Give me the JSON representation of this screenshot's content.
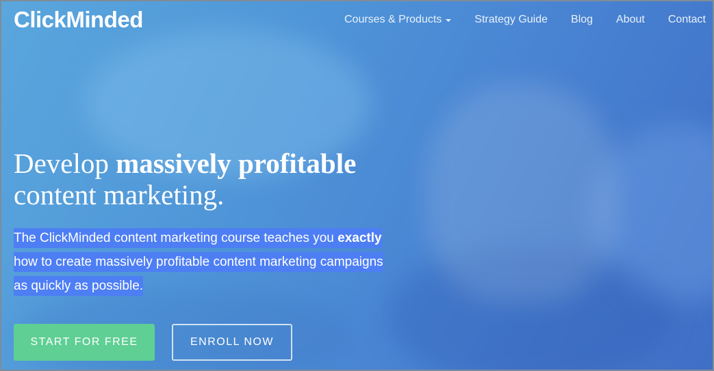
{
  "header": {
    "logo": "ClickMinded",
    "nav": [
      {
        "label": "Courses & Products",
        "has_dropdown": true
      },
      {
        "label": "Strategy Guide"
      },
      {
        "label": "Blog"
      },
      {
        "label": "About"
      },
      {
        "label": "Contact"
      }
    ]
  },
  "hero": {
    "headline_part1": "Develop ",
    "headline_bold": "massively profitable",
    "headline_part2": "content marketing.",
    "desc_part1": "The ClickMinded content marketing course teaches you ",
    "desc_bold": "exactly",
    "desc_part2": " how to create massively profitable content marketing campaigns as quickly as possible."
  },
  "buttons": {
    "start": "START FOR FREE",
    "enroll": "ENROLL NOW"
  },
  "colors": {
    "highlight": "#4d7ef4",
    "start_button": "#5fcf94",
    "background": "#4f96d8"
  }
}
